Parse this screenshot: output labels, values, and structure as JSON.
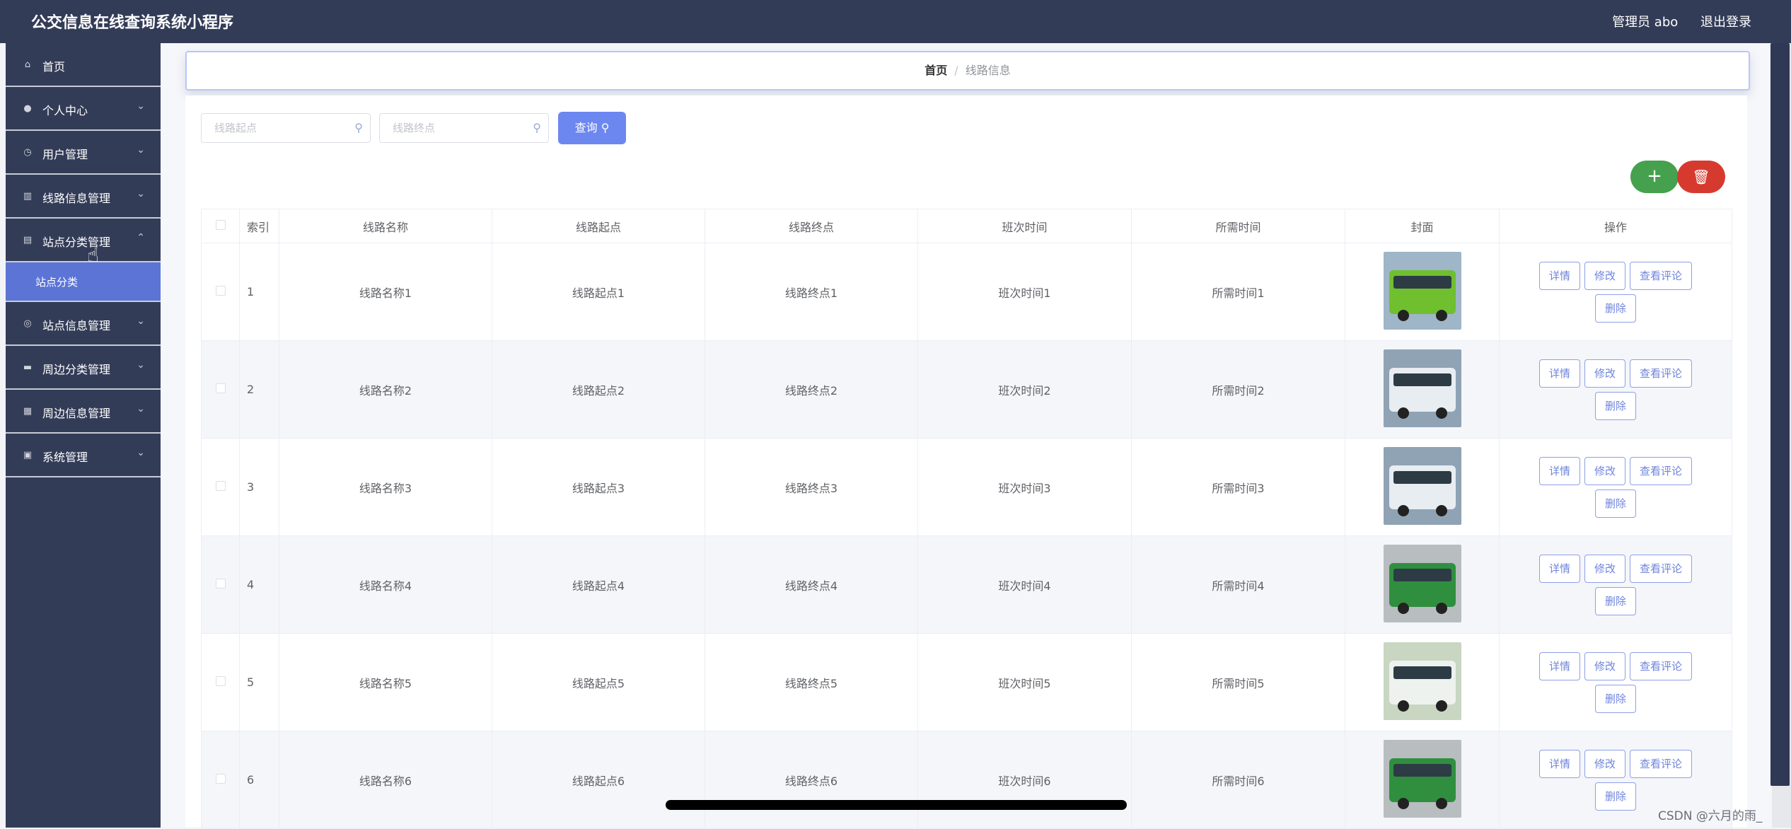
{
  "header": {
    "title": "公交信息在线查询系统小程序",
    "admin": "管理员 abo",
    "logout": "退出登录"
  },
  "sidebar": {
    "items": [
      {
        "label": "首页",
        "icon": "home-icon"
      },
      {
        "label": "个人中心",
        "icon": "user-icon"
      },
      {
        "label": "用户管理",
        "icon": "clock-icon"
      },
      {
        "label": "线路信息管理",
        "icon": "chart-icon"
      },
      {
        "label": "站点分类管理",
        "icon": "clipboard-icon"
      },
      {
        "label": "站点信息管理",
        "icon": "compass-icon"
      },
      {
        "label": "周边分类管理",
        "icon": "box-icon"
      },
      {
        "label": "周边信息管理",
        "icon": "grid-icon"
      },
      {
        "label": "系统管理",
        "icon": "settings-icon"
      }
    ],
    "submenu": {
      "label": "站点分类"
    }
  },
  "breadcrumb": {
    "home": "首页",
    "separator": "/",
    "current": "线路信息"
  },
  "search": {
    "start_placeholder": "线路起点",
    "end_placeholder": "线路终点",
    "query_label": "查询"
  },
  "toolbar": {
    "add_icon": "plus-icon",
    "delete_icon": "trash-icon",
    "add_color": "#45a14d",
    "delete_color": "#d63a2f"
  },
  "table": {
    "headers": [
      "索引",
      "线路名称",
      "线路起点",
      "线路终点",
      "班次时间",
      "所需时间",
      "封面",
      "操作"
    ],
    "rows": [
      {
        "index": "1",
        "name": "线路名称1",
        "start": "线路起点1",
        "end": "线路终点1",
        "schedule": "班次时间1",
        "duration": "所需时间1"
      },
      {
        "index": "2",
        "name": "线路名称2",
        "start": "线路起点2",
        "end": "线路终点2",
        "schedule": "班次时间2",
        "duration": "所需时间2"
      },
      {
        "index": "3",
        "name": "线路名称3",
        "start": "线路起点3",
        "end": "线路终点3",
        "schedule": "班次时间3",
        "duration": "所需时间3"
      },
      {
        "index": "4",
        "name": "线路名称4",
        "start": "线路起点4",
        "end": "线路终点4",
        "schedule": "班次时间4",
        "duration": "所需时间4"
      },
      {
        "index": "5",
        "name": "线路名称5",
        "start": "线路起点5",
        "end": "线路终点5",
        "schedule": "班次时间5",
        "duration": "所需时间5"
      },
      {
        "index": "6",
        "name": "线路名称6",
        "start": "线路起点6",
        "end": "线路终点6",
        "schedule": "班次时间6",
        "duration": "所需时间6"
      }
    ],
    "actions": {
      "detail": "详情",
      "edit": "修改",
      "comments": "查看评论",
      "delete": "删除"
    }
  },
  "watermark": "CSDN @六月的雨_"
}
